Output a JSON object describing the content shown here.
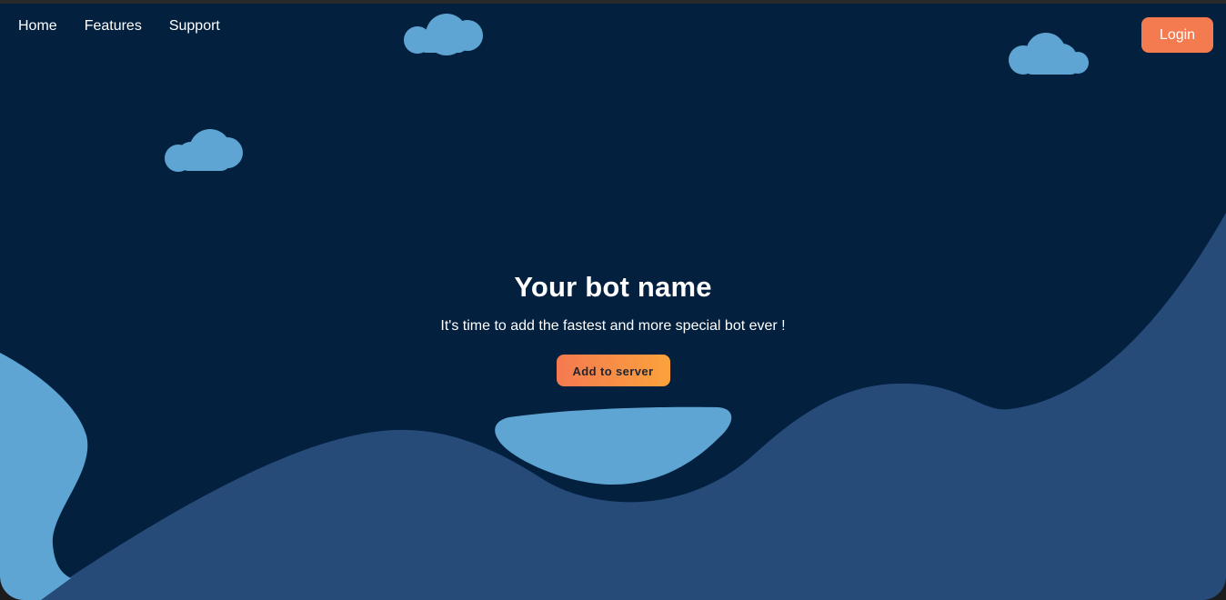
{
  "nav": {
    "items": [
      {
        "label": "Home"
      },
      {
        "label": "Features"
      },
      {
        "label": "Support"
      }
    ],
    "login_label": "Login"
  },
  "hero": {
    "title": "Your bot name",
    "subtitle": "It's time to add the fastest and more special bot ever !",
    "cta_label": "Add to server"
  },
  "colors": {
    "background": "#03203f",
    "wave": "#274b79",
    "cloud": "#5fa5d3",
    "login_button": "#f47a50",
    "cta_gradient_start": "#f47a50",
    "cta_gradient_end": "#fba23c"
  }
}
